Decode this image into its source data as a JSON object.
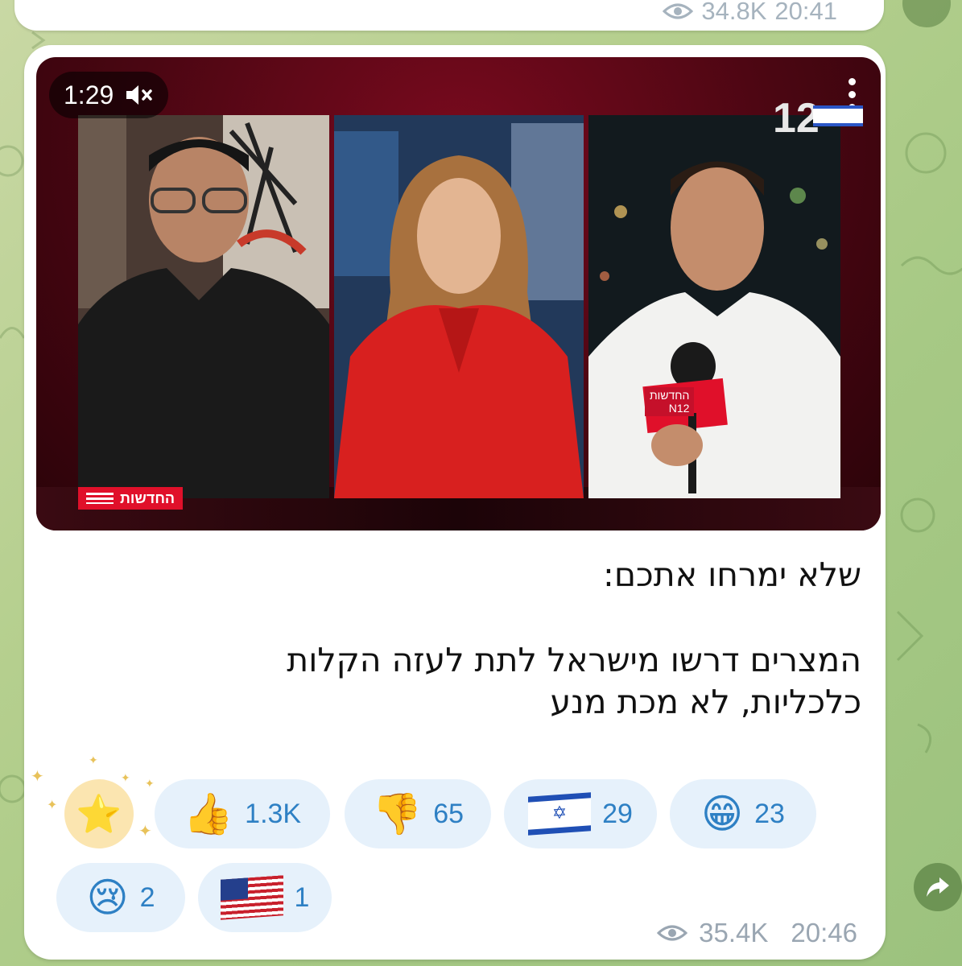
{
  "previous_message": {
    "views": "34.8K",
    "time": "20:41",
    "icons": {
      "views": "eye-icon"
    }
  },
  "message": {
    "video": {
      "duration": "1:29",
      "channel_number": "12",
      "lower_third_label": "החדשות",
      "mic_label_top": "החדשות",
      "mic_label_bottom": "N12",
      "icons": {
        "muted": "speaker-muted-icon",
        "menu": "more-vertical-icon"
      }
    },
    "caption": {
      "line1": "שלא ימרחו אתכם:",
      "line2": "המצרים דרשו מישראל לתת לעזה הקלות",
      "line3": "כלכליות, לא מכת מנע"
    },
    "reactions": [
      {
        "type": "star",
        "emoji": "⭐",
        "count": ""
      },
      {
        "type": "thumbs-up",
        "emoji": "👍",
        "count": "1.3K"
      },
      {
        "type": "thumbs-down",
        "emoji": "👎",
        "count": "65"
      },
      {
        "type": "israel-flag",
        "emoji": "🇮🇱",
        "count": "29"
      },
      {
        "type": "grin",
        "emoji": "😁",
        "count": "23"
      },
      {
        "type": "crying",
        "emoji": "😢",
        "count": "2"
      },
      {
        "type": "us-flag",
        "emoji": "🇺🇸",
        "count": "1"
      }
    ],
    "views": "35.4K",
    "time": "20:46"
  },
  "colors": {
    "reaction_bg": "#e6f1fb",
    "reaction_text": "#2e80c4",
    "meta_text": "#9aa6b2",
    "wallpaper": "#b5cf8e"
  }
}
